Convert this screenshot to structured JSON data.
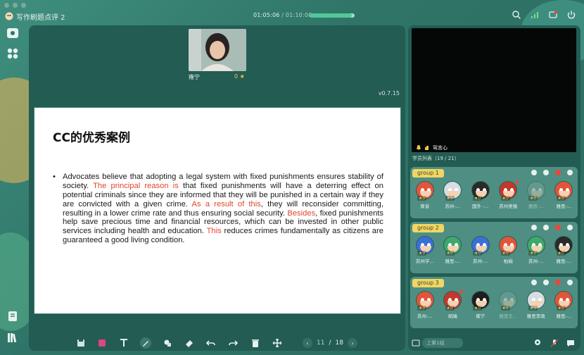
{
  "window": {
    "title": "写作刷题点评 2",
    "elapsed": "01:05:06",
    "total": "01:10:00",
    "progress_fraction": 0.93
  },
  "teacher": {
    "name": "雍宁",
    "stars": "0"
  },
  "version": "v0.7.15",
  "slide": {
    "title": "CC的优秀案例",
    "segments": [
      {
        "t": "Advocates believe that adopting a legal system with fixed punishments ensures stability of society. ",
        "hl": false
      },
      {
        "t": "The principal reason is",
        "hl": true
      },
      {
        "t": " that fixed punishments will have a deterring effect on potential criminals since they are informed that they will be punished in a certain way if they are convicted with a given crime. ",
        "hl": false
      },
      {
        "t": "As a result of this",
        "hl": true
      },
      {
        "t": ", they will reconsider committing, resulting in a lower crime rate and thus ensuring social security. ",
        "hl": false
      },
      {
        "t": "Besides",
        "hl": true
      },
      {
        "t": ", fixed punishments help save precious time and financial resources, which can be invested in other public services including health and education. ",
        "hl": false
      },
      {
        "t": "This",
        "hl": true
      },
      {
        "t": " reduces crimes fundamentally as citizens are guaranteed a good living condition.",
        "hl": false
      }
    ]
  },
  "pager": {
    "current": "11",
    "sep": "/",
    "total": "18"
  },
  "student_video": {
    "name": "驾言心"
  },
  "roster": {
    "label": "学员列表（19 / 21）"
  },
  "groups": [
    {
      "label": "group 1",
      "students": [
        {
          "name": "周音",
          "score": "0",
          "color": "#e2553a",
          "dim": false,
          "badge": false
        },
        {
          "name": "苏州-...",
          "score": "0",
          "color": "#d8dde3",
          "dim": false,
          "badge": false
        },
        {
          "name": "国外 -...",
          "score": "0",
          "color": "#2a2a2a",
          "dim": false,
          "badge": false
        },
        {
          "name": "苏州吴憶",
          "score": "0",
          "color": "#c0392b",
          "dim": false,
          "badge": true
        },
        {
          "name": "雅思-...",
          "score": "0",
          "color": "#7aa39a",
          "dim": true,
          "badge": false
        },
        {
          "name": "雅思-...",
          "score": "0",
          "color": "#e2553a",
          "dim": false,
          "badge": false
        }
      ]
    },
    {
      "label": "group 2",
      "students": [
        {
          "name": "苏州学...",
          "score": "0",
          "color": "#3b6fd8",
          "dim": false,
          "badge": false
        },
        {
          "name": "雅思-...",
          "score": "0",
          "color": "#3fa86a",
          "dim": false,
          "badge": false
        },
        {
          "name": "苏州-...",
          "score": "0",
          "color": "#3b6fd8",
          "dim": false,
          "badge": false
        },
        {
          "name": "柏娟",
          "score": "0",
          "color": "#e2553a",
          "dim": false,
          "badge": false
        },
        {
          "name": "苏州-...",
          "score": "0",
          "color": "#3fa86a",
          "dim": false,
          "badge": false
        },
        {
          "name": "雅思-...",
          "score": "0",
          "color": "#2a2a2a",
          "dim": false,
          "badge": false
        }
      ]
    },
    {
      "label": "group 3",
      "students": [
        {
          "name": "苏州-...",
          "score": "0",
          "color": "#e2553a",
          "dim": false,
          "badge": false
        },
        {
          "name": "胡瑞",
          "score": "0",
          "color": "#c0392b",
          "dim": false,
          "badge": true
        },
        {
          "name": "雍宁",
          "score": "0",
          "color": "#1e1e1e",
          "dim": false,
          "badge": false
        },
        {
          "name": "雅思王...",
          "score": "0",
          "color": "#7aa39a",
          "dim": true,
          "badge": false
        },
        {
          "name": "雅思李政",
          "score": "0",
          "color": "#d8dde3",
          "dim": false,
          "badge": false
        },
        {
          "name": "雅思-...",
          "score": "0",
          "color": "#e2553a",
          "dim": false,
          "badge": false
        }
      ]
    }
  ],
  "bottom": {
    "input_placeholder": "上第1组"
  },
  "icons": [
    "search-icon",
    "signal-icon",
    "record-icon",
    "exit-icon",
    "camera-icon",
    "apps-icon",
    "courseware-icon",
    "library-icon"
  ]
}
